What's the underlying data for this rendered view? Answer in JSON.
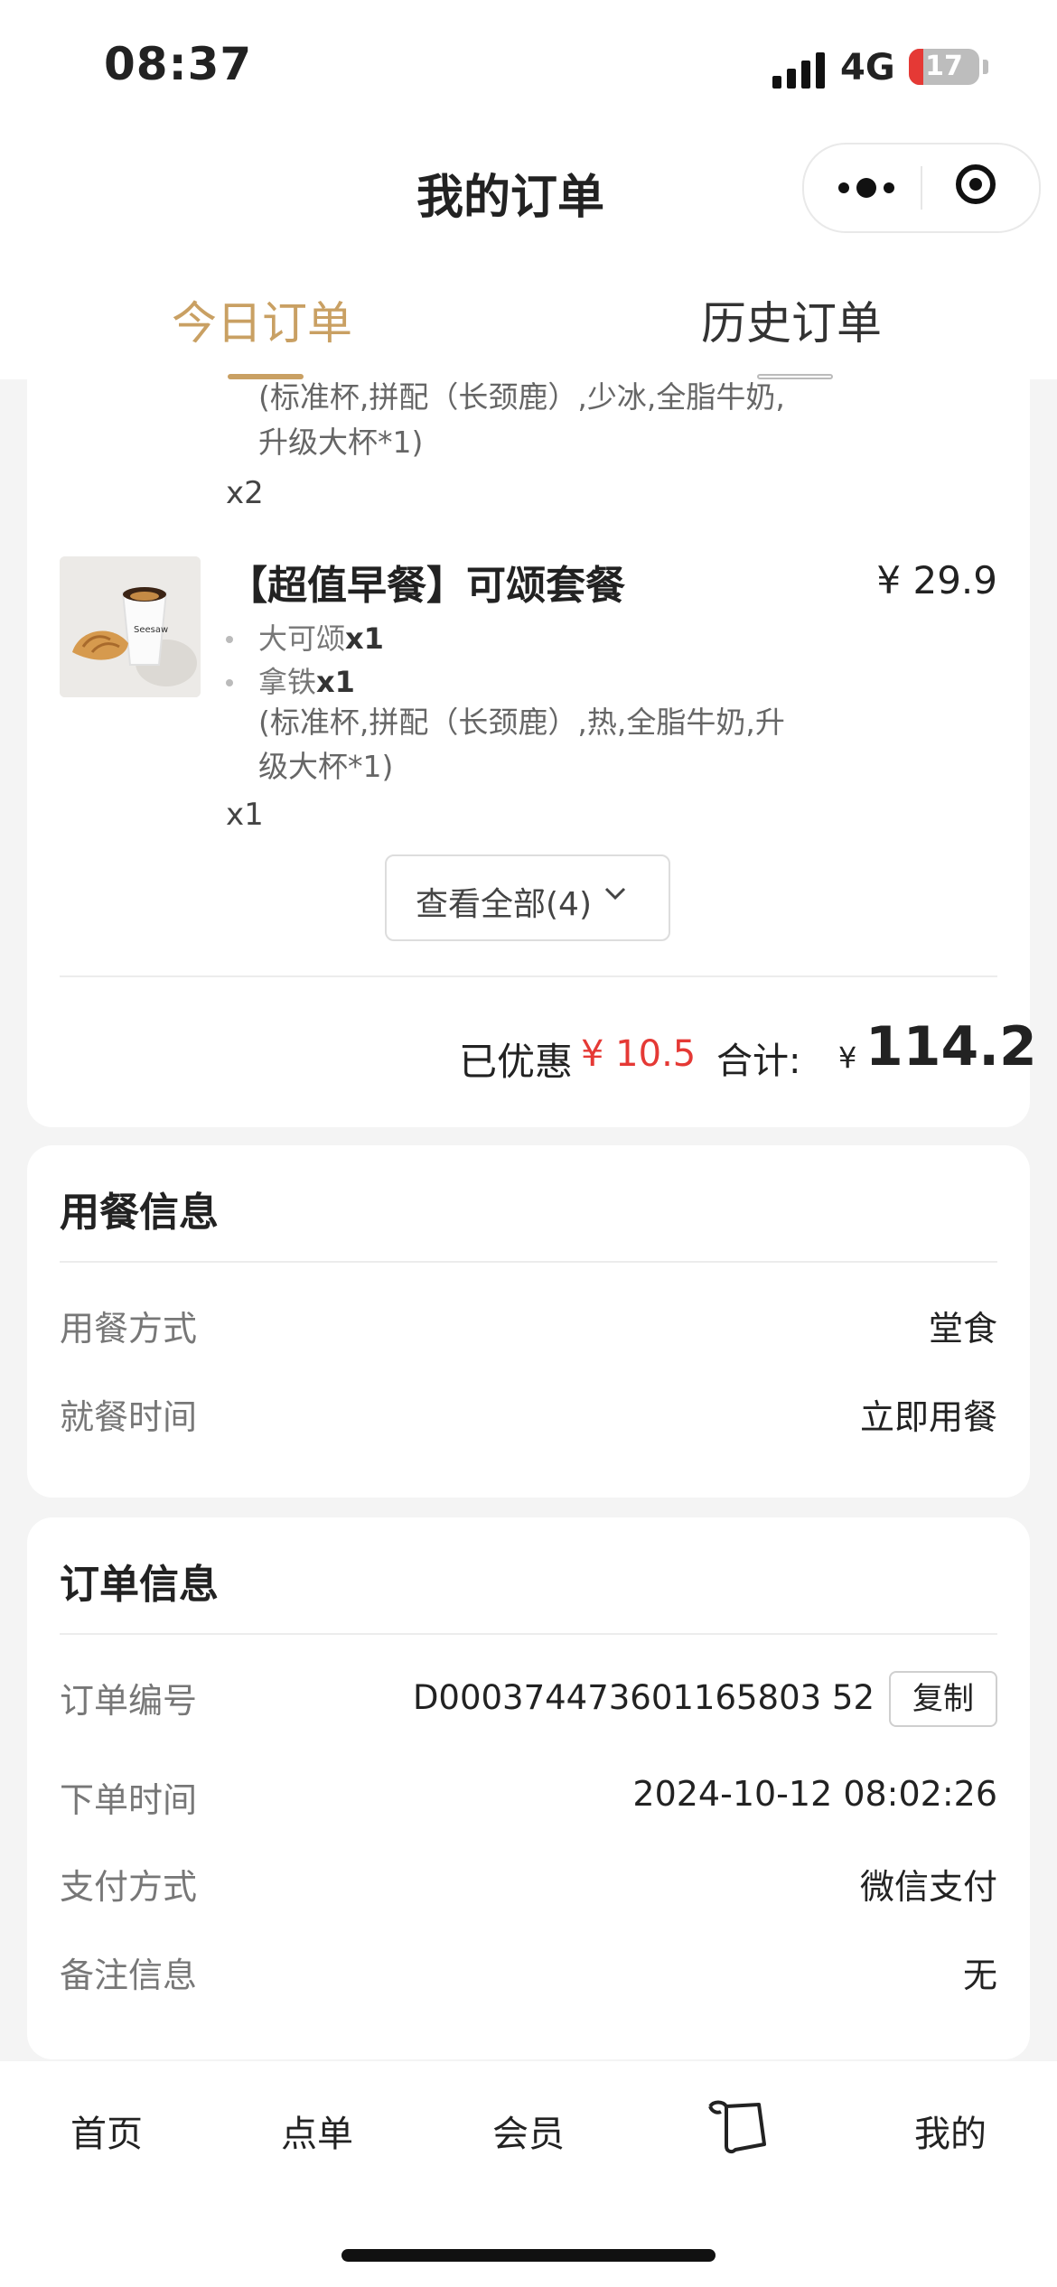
{
  "status_bar": {
    "time": "08:37",
    "network": "4G",
    "battery": "17"
  },
  "header": {
    "title": "我的订单"
  },
  "tabs": [
    {
      "label": "今日订单"
    },
    {
      "label": "历史订单"
    }
  ],
  "order": {
    "prev_item": {
      "spec_line1": "(标准杯,拼配（长颈鹿）,少冰,全脂牛奶,",
      "spec_line2": "升级大杯*1)",
      "qty": "x2"
    },
    "item": {
      "name": "【超值早餐】可颂套餐",
      "price": "¥ 29.9",
      "sub1_name": "大可颂",
      "sub1_qty": "x1",
      "sub2_name": "拿铁",
      "sub2_qty": "x1",
      "spec_line1": "(标准杯,拼配（长颈鹿）,热,全脂牛奶,升",
      "spec_line2": "级大杯*1)",
      "qty": "x1"
    },
    "view_all": "查看全部(4)",
    "discount_label": "已优惠",
    "discount_value": "¥ 10.5",
    "total_label": "合计:",
    "total_currency": "¥",
    "total_value": "114.2"
  },
  "meal_info": {
    "title": "用餐信息",
    "rows": [
      {
        "label": "用餐方式",
        "value": "堂食"
      },
      {
        "label": "就餐时间",
        "value": "立即用餐"
      }
    ]
  },
  "order_info": {
    "title": "订单信息",
    "order_no_label": "订单编号",
    "order_no": "D000374473601165803 52",
    "copy_label": "复制",
    "rows": [
      {
        "label": "下单时间",
        "value": "2024-10-12 08:02:26"
      },
      {
        "label": "支付方式",
        "value": "微信支付"
      },
      {
        "label": "备注信息",
        "value": "无"
      }
    ]
  },
  "bottom_nav": [
    "首页",
    "点单",
    "会员",
    "我的"
  ],
  "colors": {
    "accent_gold": "#c9a063",
    "discount_red": "#e53935"
  }
}
